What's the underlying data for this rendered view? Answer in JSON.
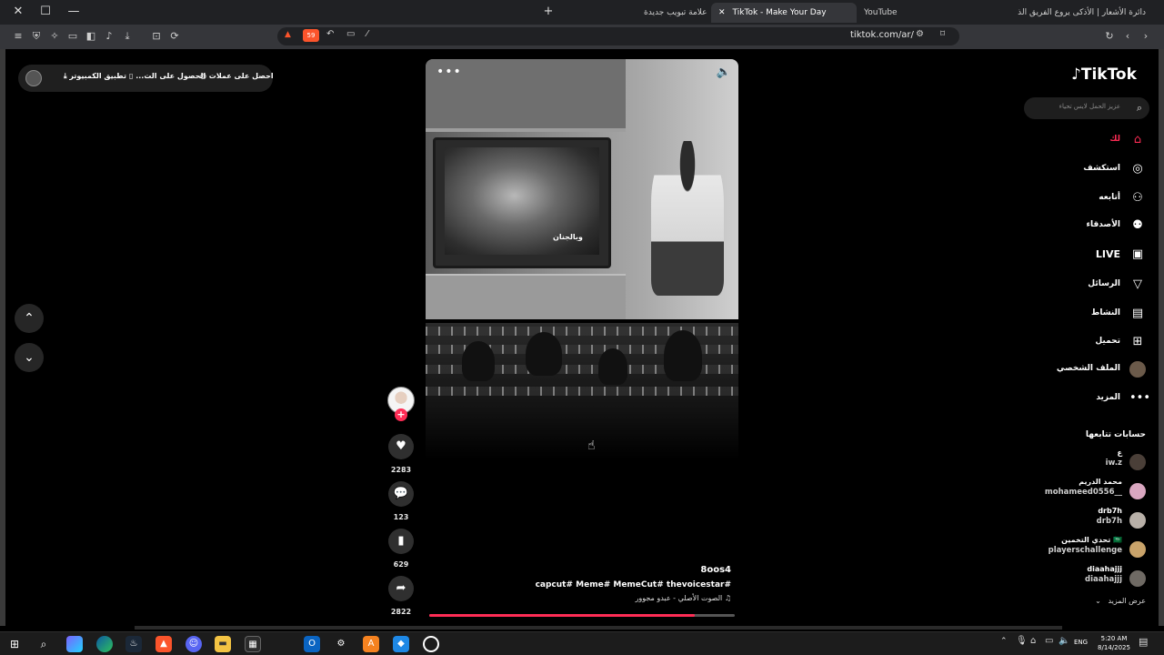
{
  "browser": {
    "tabs": [
      {
        "label": "YouTube",
        "active": false
      },
      {
        "label": "TikTok - Make Your Day",
        "active": true
      },
      {
        "label": "علامة تبويب جديدة",
        "active": false
      },
      {
        "label": "دائرة الأشعار | الأذكى يروع الفريق الذ",
        "active": false
      }
    ],
    "url": "tiktok.com/ar/",
    "shield_count": "59"
  },
  "promo": {
    "earn_label": "احصل على عملات",
    "get_app_label": "الحصول على الت...",
    "desktop_label": "تطبيق الكمبيوتر"
  },
  "video": {
    "caption_overlay": "وبالجنان",
    "author": "8oos4",
    "tags": "capcut#  Meme#  MemeCut#  thevoicestar#",
    "music": "الصوت الأصلي - عبدو مجوور",
    "progress": 0.87
  },
  "actions": {
    "likes": "2283",
    "comments": "123",
    "saves": "629",
    "shares": "2822"
  },
  "sidebar": {
    "logo": "TikTok",
    "search_placeholder": "عزيز الحمل لايس تحياء",
    "nav": [
      {
        "label": "لك",
        "icon": "home-icon",
        "active": true
      },
      {
        "label": "استكشف",
        "icon": "compass-icon"
      },
      {
        "label": "أتابعه",
        "icon": "following-icon"
      },
      {
        "label": "الأصدقاء",
        "icon": "friends-icon"
      },
      {
        "label": "LIVE",
        "icon": "live-icon"
      },
      {
        "label": "الرسائل",
        "icon": "messages-icon"
      },
      {
        "label": "النشاط",
        "icon": "activity-icon"
      },
      {
        "label": "تحميل",
        "icon": "upload-icon"
      },
      {
        "label": "الملف الشخصي",
        "icon": "profile-icon"
      },
      {
        "label": "المزيد",
        "icon": "more-icon"
      }
    ],
    "following_title": "حسابات تتابعها",
    "accounts": [
      {
        "name": "ع",
        "user": "iw.z"
      },
      {
        "name": "محمد الدريم",
        "user": "mohameed0556__"
      },
      {
        "name": "drb7h",
        "user": "drb7h"
      },
      {
        "name": "تحدي التخمين 🇸🇦",
        "user": "playerschallenge"
      },
      {
        "name": "diaahajjj",
        "user": "diaahajjj"
      }
    ],
    "see_more": "عرض المزيد"
  },
  "taskbar": {
    "lang": "ENG",
    "time": "5:20 AM",
    "date": "8/14/2025"
  },
  "colors": {
    "accent": "#fe2c55",
    "page_bg": "#000000",
    "toolbar_bg": "#35363a"
  }
}
